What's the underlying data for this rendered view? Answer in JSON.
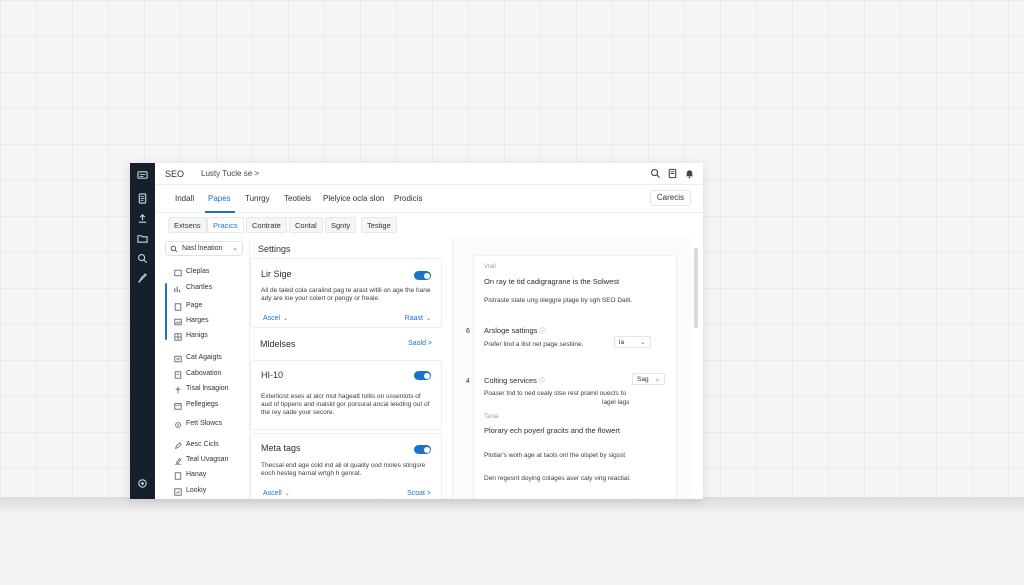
{
  "window": {
    "app_title": "SEO",
    "breadcrumb": "Lusty Tucle se  >"
  },
  "top_tabs": [
    {
      "label": "Indall"
    },
    {
      "label": "Papes"
    },
    {
      "label": "Tunrgy"
    },
    {
      "label": "Teotiels"
    },
    {
      "label": "Plelyice ocla slon"
    },
    {
      "label": "Prodicis"
    }
  ],
  "contacts_button": "Carecis",
  "sub_tabs": [
    {
      "label": "Extsens"
    },
    {
      "label": "Pracics"
    },
    {
      "label": "Contrate"
    },
    {
      "label": "Contal"
    },
    {
      "label": "Sgnty"
    },
    {
      "label": "Testige"
    }
  ],
  "sidebar": {
    "search_text": "Nasl lneation",
    "items": [
      {
        "label": "Cleplas"
      },
      {
        "label": "Chartles"
      },
      {
        "label": "Page"
      },
      {
        "label": "Harges"
      },
      {
        "label": "Hanigs"
      },
      {
        "label": "Cat Agaigts"
      },
      {
        "label": "Cabovation"
      },
      {
        "label": "Tisal lnsagion"
      },
      {
        "label": "Pellegiegs"
      },
      {
        "label": "Fett Slowcs"
      },
      {
        "label": "Aesc Cicls"
      },
      {
        "label": "Teal Uvagsan"
      },
      {
        "label": "Hanay"
      },
      {
        "label": "Lookiy"
      }
    ]
  },
  "middle": {
    "section_title": "Settings",
    "cards": [
      {
        "title": "Lir Sige",
        "desc": "All de taled cola caralind pag te arast witili on age the hane ady are loe your colert or pengy or freale.",
        "left_action": "Ascel",
        "right_action": "Raast"
      },
      {
        "title": "Mldelses",
        "right_action": "Saold >"
      },
      {
        "title": "HI-10",
        "desc": "Exterlicist eses at alcr mut hageatt tolits on ussenlots of aud of tippens and inalsld gor porsural ancal leedlng out of the rey sade your secore."
      },
      {
        "title": "Meta tags",
        "desc": "Thecsal end age cold ind ali ol quality ood moles stingsre eoch hesteg harnal wrtgh h genrat.",
        "left_action": "Ascell",
        "right_action": "Scoat >"
      }
    ]
  },
  "right_panel": {
    "small_label_1": "Vrall",
    "heading_1": "On ray te tid cadigragrane is the Solwest",
    "line_1": "Pistraste state ung oleggre plage by sgh SEO Daiti.",
    "num_1": "6",
    "setting_1_title": "Arsloge sattings",
    "setting_1_desc": "Prefer tind a llist net page sestiine.",
    "setting_1_value": "la",
    "num_2": "4",
    "setting_2_title": "Colting services",
    "setting_2_desc": "Poaser tnd to ned cealy stse rest prainil ouects to",
    "setting_2_desc_2": "lagel lags",
    "setting_2_value": "Sag",
    "small_label_2": "Tanla",
    "heading_2": "Plorary ech poyerl gracits and the flowert",
    "line_2": "Plotlar's wolh age at taols onl the olspet by sigsst",
    "line_3": "Den regesnt doying colages aser caly ving reactial."
  }
}
